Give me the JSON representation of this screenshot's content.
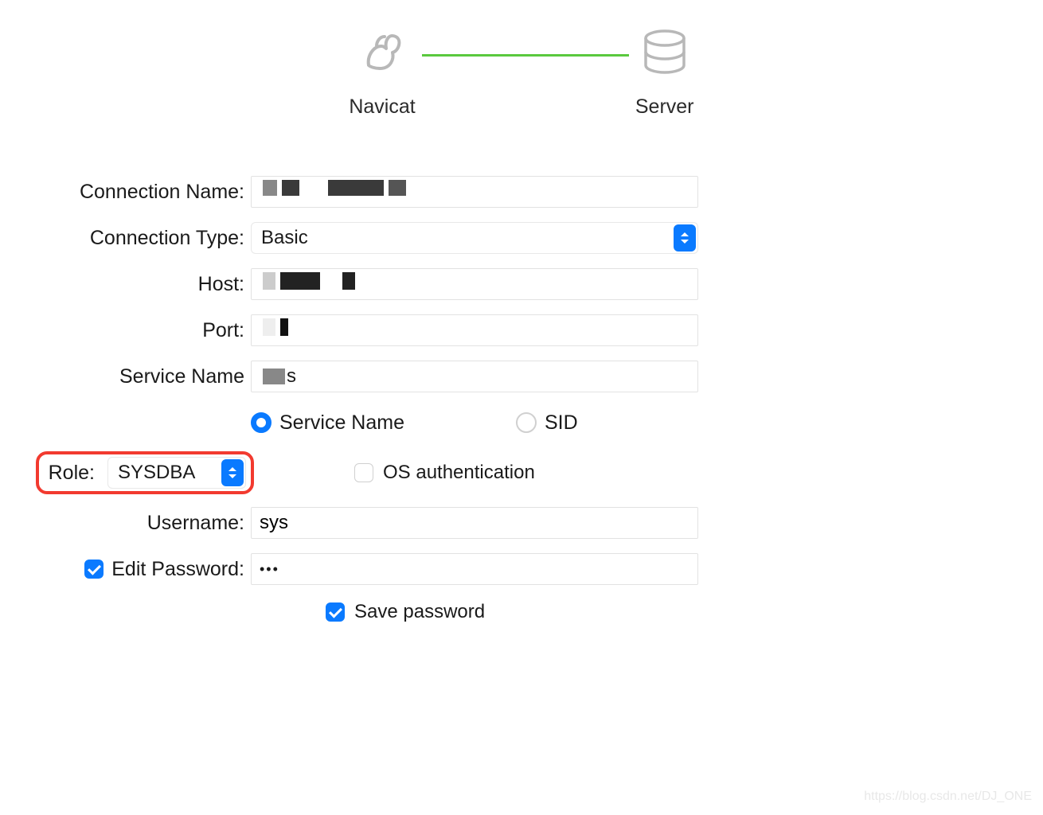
{
  "header": {
    "navicat_label": "Navicat",
    "server_label": "Server"
  },
  "form": {
    "connection_name_label": "Connection Name:",
    "connection_type_label": "Connection Type:",
    "connection_type_value": "Basic",
    "host_label": "Host:",
    "port_label": "Port:",
    "service_name_label": "Service Name",
    "radio_service_name": "Service Name",
    "radio_sid": "SID",
    "role_label": "Role:",
    "role_value": "SYSDBA",
    "os_auth_label": "OS authentication",
    "username_label": "Username:",
    "username_value": "sys",
    "edit_password_label": "Edit Password:",
    "password_value": "•••",
    "save_password_label": "Save password"
  },
  "watermark": "https://blog.csdn.net/DJ_ONE"
}
